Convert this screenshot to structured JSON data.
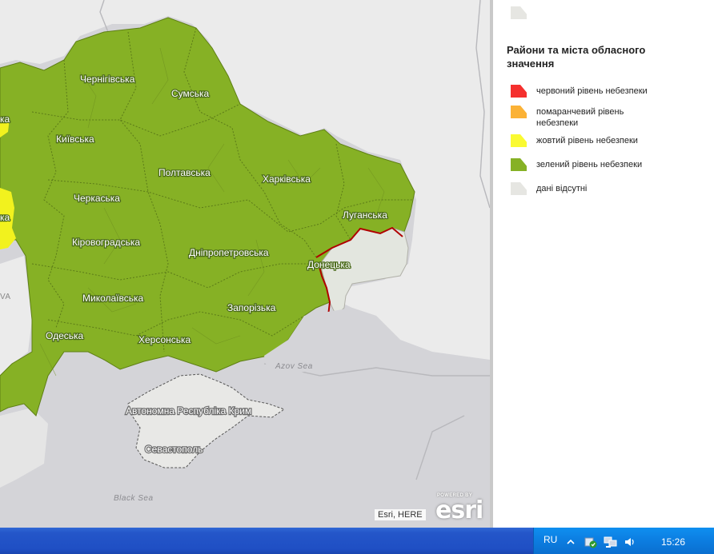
{
  "map": {
    "regions": [
      {
        "name": "Чернігівська",
        "level": "green"
      },
      {
        "name": "Сумська",
        "level": "green"
      },
      {
        "name": "Київська",
        "level": "green"
      },
      {
        "name": "Полтавська",
        "level": "green"
      },
      {
        "name": "Харківська",
        "level": "green"
      },
      {
        "name": "Черкаська",
        "level": "green"
      },
      {
        "name": "Луганська",
        "level": "green"
      },
      {
        "name": "Кіровоградська",
        "level": "green"
      },
      {
        "name": "Дніпропетровська",
        "level": "green"
      },
      {
        "name": "Донецька",
        "level": "mixed"
      },
      {
        "name": "Миколаївська",
        "level": "green"
      },
      {
        "name": "Запорізька",
        "level": "green"
      },
      {
        "name": "Одеська",
        "level": "green"
      },
      {
        "name": "Херсонська",
        "level": "green"
      },
      {
        "name": "Автономна Республіка Крим",
        "level": "none"
      },
      {
        "name": "Севастополь",
        "level": "none"
      }
    ],
    "partial_labels": [
      "ка",
      "ка",
      "VA"
    ],
    "seas": [
      "Azov Sea",
      "Black Sea"
    ],
    "attribution": "Esri, HERE",
    "logo": {
      "powered": "POWERED BY",
      "word": "esri"
    },
    "colors": {
      "green": "#86b125",
      "yellow": "#f2f21e",
      "red": "#b00000",
      "nodata": "#e3e6df",
      "sea": "#d4d4d8",
      "land_gray": "#ebebeb"
    }
  },
  "legend": {
    "title": "Райони та міста обласного значення",
    "items": [
      {
        "label": "червоний рівень небезпеки",
        "color": "#f5302e"
      },
      {
        "label": "помаранчевий рівень небезпеки",
        "color": "#fbb236"
      },
      {
        "label": "жовтий рівень небезпеки",
        "color": "#fafa32"
      },
      {
        "label": "зелений рівень небезпеки",
        "color": "#86b125"
      },
      {
        "label": "дані відсутні",
        "color": "#e6e6e2"
      }
    ],
    "top_swatch_color": "#e6e6e2"
  },
  "taskbar": {
    "language": "RU",
    "time": "15:26",
    "icons": [
      "show-hidden-icon",
      "security-icon",
      "network-icon",
      "volume-icon"
    ]
  }
}
